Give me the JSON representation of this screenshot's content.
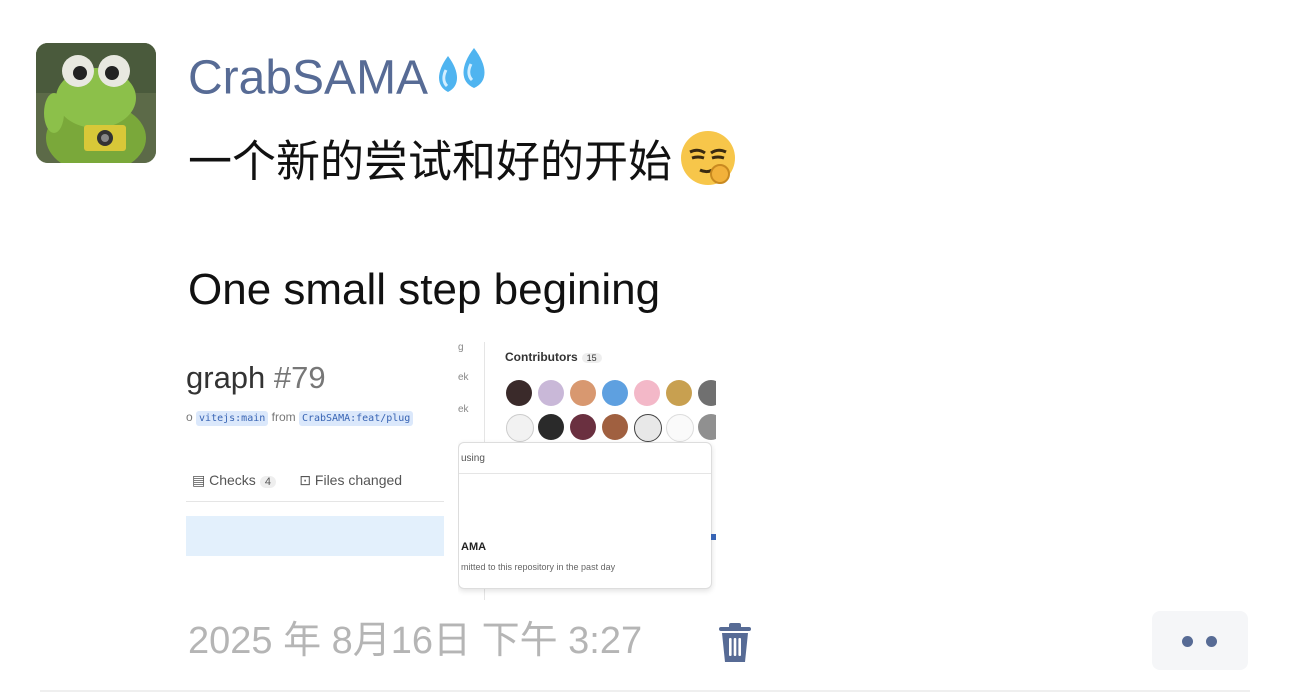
{
  "post": {
    "username": "CrabSAMA",
    "text_line1": "一个新的尝试和好的开始",
    "text_line2": "One small step begining",
    "timestamp": "2025 年 8月16日 下午 3:27"
  },
  "image_left": {
    "title": "graph",
    "pr_number": "#79",
    "branch_prefix": "o",
    "base_branch": "vitejs:main",
    "from_text": "from",
    "head_branch": "CrabSAMA:feat/plug",
    "checks_label": "Checks",
    "checks_count": "4",
    "files_label": "Files changed"
  },
  "image_right": {
    "contributors_label": "Contributors",
    "contributors_count": "15",
    "side_1": "g",
    "side_2": "ek",
    "side_3": "ek",
    "using_label": "using",
    "popup_name": "AMA",
    "popup_sub": "mitted to this repository in the past day"
  },
  "icons": {
    "username_emoji": "sweat-droplets-icon",
    "text_emoji": "smirking-ok-hand-emoji-icon",
    "delete": "trash-icon",
    "more": "more-dots-icon"
  },
  "colors": {
    "name_blue": "#576b95",
    "timestamp_gray": "#b5b5b5",
    "text_black": "#111111"
  }
}
